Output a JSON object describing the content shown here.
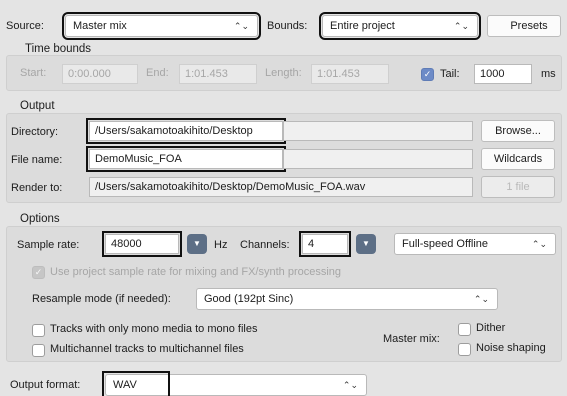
{
  "top": {
    "source_label": "Source:",
    "source_value": "Master mix",
    "bounds_label": "Bounds:",
    "bounds_value": "Entire project",
    "presets_label": "Presets"
  },
  "time_bounds": {
    "title": "Time bounds",
    "start_label": "Start:",
    "start_value": "0:00.000",
    "end_label": "End:",
    "end_value": "1:01.453",
    "length_label": "Length:",
    "length_value": "1:01.453",
    "tail_label": "Tail:",
    "tail_checked": true,
    "tail_value": "1000",
    "tail_unit": "ms"
  },
  "output": {
    "title": "Output",
    "directory_label": "Directory:",
    "directory_value": "/Users/sakamotoakihito/Desktop",
    "browse_label": "Browse...",
    "filename_label": "File name:",
    "filename_value": "DemoMusic_FOA",
    "wildcards_label": "Wildcards",
    "render_to_label": "Render to:",
    "render_to_value": "/Users/sakamotoakihito/Desktop/DemoMusic_FOA.wav",
    "file_count_label": "1 file"
  },
  "options": {
    "title": "Options",
    "sample_rate_label": "Sample rate:",
    "sample_rate_value": "48000",
    "hz_label": "Hz",
    "channels_label": "Channels:",
    "channels_value": "4",
    "mode_value": "Full-speed Offline",
    "use_project_rate_label": "Use project sample rate for mixing and FX/synth processing",
    "use_project_rate_checked": true,
    "resample_label": "Resample mode (if needed):",
    "resample_value": "Good (192pt Sinc)",
    "mono_label": "Tracks with only mono media to mono files",
    "multichannel_label": "Multichannel tracks to multichannel files",
    "master_mix_label": "Master mix:",
    "dither_label": "Dither",
    "noise_shaping_label": "Noise shaping"
  },
  "format": {
    "output_format_label": "Output format:",
    "output_format_value": "WAV"
  }
}
